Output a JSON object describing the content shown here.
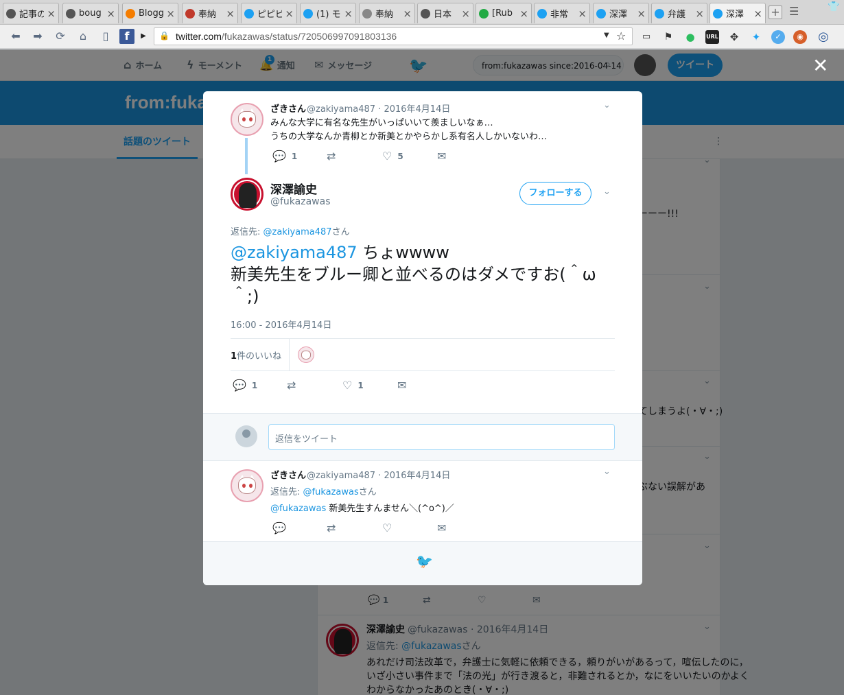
{
  "browser": {
    "tabs": [
      {
        "title": "記事の",
        "icon_color": "#555555"
      },
      {
        "title": "boug",
        "icon_color": "#555555"
      },
      {
        "title": "Blogg",
        "icon_color": "#f57d00"
      },
      {
        "title": "奉納",
        "icon_color": "#c0392b"
      },
      {
        "title": "ピピピ",
        "icon_color": "#1da1f2"
      },
      {
        "title": "(1) モ",
        "icon_color": "#1da1f2"
      },
      {
        "title": "奉納",
        "icon_color": "#888888"
      },
      {
        "title": "日本",
        "icon_color": "#555555"
      },
      {
        "title": "[Rub",
        "icon_color": "#22aa44"
      },
      {
        "title": "非常",
        "icon_color": "#1da1f2"
      },
      {
        "title": "深澤",
        "icon_color": "#1da1f2"
      },
      {
        "title": "弁護",
        "icon_color": "#1da1f2"
      },
      {
        "title": "深澤",
        "icon_color": "#1da1f2",
        "active": true
      }
    ],
    "url_host": "twitter.com",
    "url_path": "/fukazawas/status/720506997091803136",
    "ext_url_label": "URL"
  },
  "twitter_nav": {
    "home": "ホーム",
    "moments": "モーメント",
    "notifications": "通知",
    "notifications_badge": "1",
    "messages": "メッセージ",
    "search_value": "from:fukazawas since:2016-04-14",
    "tweet_button": "ツイート"
  },
  "header": {
    "title": "from:fuka",
    "tab_top": "話題のツイート"
  },
  "background": {
    "snippet1": "ーーー!!!",
    "snippet2": "てしまうよ(・∀・;)",
    "snippet3": "ぶない誤解があ",
    "reply_count": "1",
    "last_tweet": {
      "name": "深澤諭史",
      "handle": "@fukazawas",
      "date": "2016年4月14日",
      "reply_to_label": "返信先:",
      "reply_to_user": "@fukazawas",
      "reply_to_suffix": "さん",
      "line1": "あれだけ司法改革で，弁護士に気軽に依頼できる，頼りがいがあるって，喧伝したのに，",
      "line2": "いざ小さい事件まで「法の光」が行き渡ると，非難されるとか，なにをいいたいのかよく",
      "line3": "わからなかったあのとき(・∀・;)"
    }
  },
  "modal": {
    "parent_tweet": {
      "name": "ざきさん",
      "handle": "@zakiyama487",
      "date": "2016年4月14日",
      "line1": "みんな大学に有名な先生がいっぱいいて羨ましいなぁ…",
      "line2": "うちの大学なんか青柳とか新美とかやらかし系有名人しかいないわ…",
      "replies": "1",
      "likes": "5"
    },
    "main_tweet": {
      "name": "深澤諭史",
      "handle": "@fukazawas",
      "follow_button": "フォローする",
      "reply_to_label": "返信先:",
      "reply_to_user": "@zakiyama487",
      "reply_to_suffix": "さん",
      "mention": "@zakiyama487",
      "text1": " ちょwwww",
      "text2": "新美先生をブルー卿と並べるのはダメですお(＾ω＾;)",
      "timestamp": "16:00 - 2016年4月14日",
      "likes_count": "1",
      "likes_label": "件のいいね",
      "replies": "1",
      "likes": "1"
    },
    "reply_placeholder": "返信をツイート",
    "reply_tweet": {
      "name": "ざきさん",
      "handle": "@zakiyama487",
      "date": "2016年4月14日",
      "reply_to_label": "返信先:",
      "reply_to_user": "@fukazawas",
      "reply_to_suffix": "さん",
      "mention": "@fukazawas",
      "text": " 新美先生すんません＼(^o^)／"
    }
  },
  "colors": {
    "twitter_blue": "#1da1f2",
    "header_blue": "#1b95e0",
    "text_gray": "#657786"
  }
}
